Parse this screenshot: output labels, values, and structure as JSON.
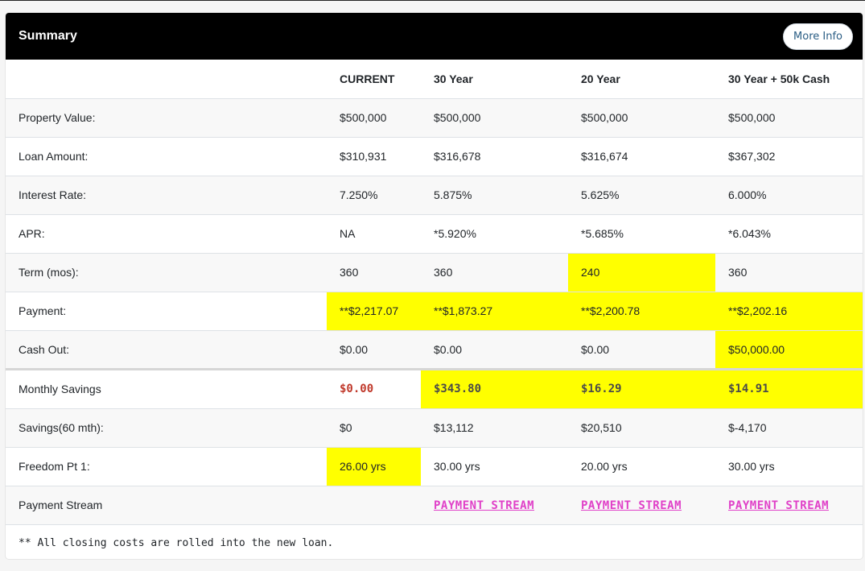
{
  "card": {
    "title": "Summary",
    "more_info_label": "More Info"
  },
  "columns": [
    "",
    "CURRENT",
    "30 Year",
    "20 Year",
    "30 Year + 50k Cash"
  ],
  "rows": [
    {
      "label": "Property Value:",
      "values": [
        "$500,000",
        "$500,000",
        "$500,000",
        "$500,000"
      ]
    },
    {
      "label": "Loan Amount:",
      "values": [
        "$310,931",
        "$316,678",
        "$316,674",
        "$367,302"
      ]
    },
    {
      "label": "Interest Rate:",
      "values": [
        "7.250%",
        "5.875%",
        "5.625%",
        "6.000%"
      ]
    },
    {
      "label": "APR:",
      "values": [
        "NA",
        "*5.920%",
        "*5.685%",
        "*6.043%"
      ]
    },
    {
      "label": "Term (mos):",
      "values": [
        "360",
        "360",
        "240",
        "360"
      ]
    },
    {
      "label": "Payment:",
      "values": [
        "**$2,217.07",
        "**$1,873.27",
        "**$2,200.78",
        "**$2,202.16"
      ]
    },
    {
      "label": "Cash Out:",
      "values": [
        "$0.00",
        "$0.00",
        "$0.00",
        "$50,000.00"
      ]
    },
    {
      "label": "Monthly Savings",
      "values": [
        "$0.00",
        "$343.80",
        "$16.29",
        "$14.91"
      ]
    },
    {
      "label": "Savings(60 mth):",
      "values": [
        "$0",
        "$13,112",
        "$20,510",
        "$-4,170"
      ]
    },
    {
      "label": "Freedom Pt 1:",
      "values": [
        "26.00 yrs",
        "30.00 yrs",
        "20.00 yrs",
        "30.00 yrs"
      ]
    },
    {
      "label": "Payment Stream",
      "values": [
        "",
        "PAYMENT STREAM",
        "PAYMENT STREAM",
        "PAYMENT STREAM"
      ]
    }
  ],
  "footnote": "** All closing costs are rolled into the new loan.",
  "colors": {
    "highlight": "#ffff00",
    "header_bg": "#000000",
    "negative": "#c0392b",
    "link": "#e040c8"
  }
}
